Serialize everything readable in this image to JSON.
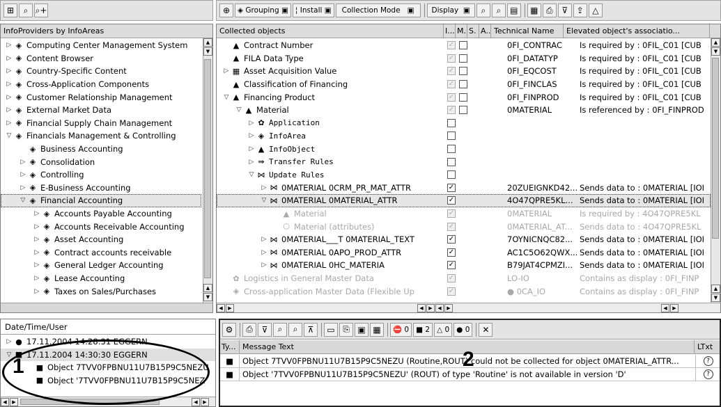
{
  "left": {
    "header": "InfoProviders by InfoAreas",
    "items": [
      {
        "label": "Computing Center Management System",
        "tw": "▷",
        "d": 0
      },
      {
        "label": "Content Browser",
        "tw": "▷",
        "d": 0
      },
      {
        "label": "Country-Specific Content",
        "tw": "▷",
        "d": 0
      },
      {
        "label": "Cross-Application Components",
        "tw": "▷",
        "d": 0
      },
      {
        "label": "Customer Relationship Management",
        "tw": "▷",
        "d": 0
      },
      {
        "label": "External Market Data",
        "tw": "▷",
        "d": 0
      },
      {
        "label": "Financial Supply Chain Management",
        "tw": "▷",
        "d": 0
      },
      {
        "label": "Financials Management & Controlling",
        "tw": "▽",
        "d": 0
      },
      {
        "label": "Business Accounting",
        "tw": "",
        "d": 1
      },
      {
        "label": "Consolidation",
        "tw": "▷",
        "d": 1
      },
      {
        "label": "Controlling",
        "tw": "▷",
        "d": 1
      },
      {
        "label": "E-Business Accounting",
        "tw": "▷",
        "d": 1
      },
      {
        "label": "Financial Accounting",
        "tw": "▽",
        "d": 1,
        "sel": true
      },
      {
        "label": "Accounts Payable Accounting",
        "tw": "▷",
        "d": 2
      },
      {
        "label": "Accounts Receivable Accounting",
        "tw": "▷",
        "d": 2
      },
      {
        "label": "Asset Accounting",
        "tw": "▷",
        "d": 2
      },
      {
        "label": "Contract accounts receivable",
        "tw": "▷",
        "d": 2
      },
      {
        "label": "General Ledger Accounting",
        "tw": "▷",
        "d": 2
      },
      {
        "label": "Lease Accounting",
        "tw": "▷",
        "d": 2
      },
      {
        "label": "Taxes on Sales/Purchases",
        "tw": "▷",
        "d": 2
      }
    ]
  },
  "toolbar": {
    "grouping": "Grouping",
    "install": "Install",
    "collection_mode": "Collection Mode",
    "display": "Display"
  },
  "grid": {
    "headers": [
      "Collected objects",
      "I...",
      "M.",
      "S.",
      "A..",
      "Technical Name",
      "Elevated object's associatio..."
    ],
    "rows": [
      {
        "name": "Contract Number",
        "tw": "",
        "d": 0,
        "ic": "▲",
        "i": "dis",
        "m": "box",
        "tech": "0FI_CONTRAC",
        "assoc": "Is required by : 0FIL_C01 [CUB"
      },
      {
        "name": "FILA Data Type",
        "tw": "",
        "d": 0,
        "ic": "▲",
        "i": "dis",
        "m": "box",
        "tech": "0FI_DATATYP",
        "assoc": "Is required by : 0FIL_C01 [CUB"
      },
      {
        "name": "Asset Acquisition Value",
        "tw": "▷",
        "d": 0,
        "ic": "▦",
        "i": "dis",
        "m": "box",
        "tech": "0FI_EQCOST",
        "assoc": "Is required by : 0FIL_C01 [CUB"
      },
      {
        "name": "Classification of Financing",
        "tw": "",
        "d": 0,
        "ic": "▲",
        "i": "dis",
        "m": "box",
        "tech": "0FI_FINCLAS",
        "assoc": "Is required by : 0FIL_C01 [CUB"
      },
      {
        "name": "Financing Product",
        "tw": "▽",
        "d": 0,
        "ic": "▲",
        "i": "dis",
        "m": "box",
        "tech": "0FI_FINPROD",
        "assoc": "Is required by : 0FIL_C01 [CUB"
      },
      {
        "name": "Material",
        "tw": "▽",
        "d": 1,
        "ic": "▲",
        "i": "dis",
        "m": "box",
        "tech": "0MATERIAL",
        "assoc": "Is referenced by : 0FI_FINPROD"
      },
      {
        "name": "Application",
        "tw": "▷",
        "d": 2,
        "ic": "✿",
        "i": "box",
        "mono": true
      },
      {
        "name": "InfoArea",
        "tw": "▷",
        "d": 2,
        "ic": "◈",
        "i": "box",
        "mono": true
      },
      {
        "name": "InfoObject",
        "tw": "▷",
        "d": 2,
        "ic": "▲",
        "i": "box",
        "mono": true
      },
      {
        "name": "Transfer Rules",
        "tw": "▷",
        "d": 2,
        "ic": "⇛",
        "i": "box",
        "mono": true
      },
      {
        "name": "Update Rules",
        "tw": "▽",
        "d": 2,
        "ic": "⋈",
        "i": "box",
        "mono": true
      },
      {
        "name": "0MATERIAL 0CRM_PR_MAT_ATTR",
        "tw": "▷",
        "d": 3,
        "ic": "⋈",
        "i": "chk",
        "tech": "20ZUEIGNKD42...",
        "assoc": "Sends data to : 0MATERIAL [IOI"
      },
      {
        "name": "0MATERIAL 0MATERIAL_ATTR",
        "tw": "▽",
        "d": 3,
        "ic": "⋈",
        "i": "chk",
        "tech": "4O47QPRE5KL...",
        "assoc": "Sends data to : 0MATERIAL [IOI",
        "sel": true
      },
      {
        "name": "Material",
        "tw": "",
        "d": 4,
        "ic": "▲",
        "i": "dis",
        "grey": true,
        "tech": "0MATERIAL",
        "assoc": "Is required by : 4O47QPRE5KL"
      },
      {
        "name": "Material (attributes)",
        "tw": "",
        "d": 4,
        "ic": "⬡",
        "i": "dis",
        "grey": true,
        "tech": "0MATERIAL_AT...",
        "assoc": "Sends data to : 4O47QPRE5KL"
      },
      {
        "name": "0MATERIAL___T 0MATERIAL_TEXT",
        "tw": "▷",
        "d": 3,
        "ic": "⋈",
        "i": "chk",
        "tech": "7OYNICNQC82...",
        "assoc": "Sends data to : 0MATERIAL [IOI"
      },
      {
        "name": "0MATERIAL 0APO_PROD_ATTR",
        "tw": "▷",
        "d": 3,
        "ic": "⋈",
        "i": "chk",
        "tech": "AC1C5O62QWX...",
        "assoc": "Sends data to : 0MATERIAL [IOI"
      },
      {
        "name": "0MATERIAL 0HC_MATERIA",
        "tw": "▷",
        "d": 3,
        "ic": "⋈",
        "i": "chk",
        "tech": "B79JAT4CPMZI...",
        "assoc": "Sends data to : 0MATERIAL [IOI"
      },
      {
        "name": "Logistics in General Master Data",
        "tw": "",
        "d": 0,
        "ic": "✿",
        "i": "dis",
        "grey": true,
        "tech": "LO-IO",
        "assoc": "Contains as display : 0FI_FINP"
      },
      {
        "name": "Cross-application Master Data (Flexible Up",
        "tw": "",
        "d": 0,
        "ic": "◈",
        "i": "dis",
        "grey": true,
        "tech": "● 0CA_IO",
        "assoc": "Contains as display : 0FI_FINP"
      }
    ]
  },
  "log": {
    "header": "Date/Time/User",
    "items": [
      {
        "text": "17.11.2004  14:28:31  EGGERN",
        "tw": "▷",
        "d": 0,
        "ic": "●"
      },
      {
        "text": "17.11.2004  14:30:30  EGGERN",
        "tw": "▽",
        "d": 0,
        "ic": "■"
      },
      {
        "text": "Object 7TVV0FPBNU11U7B15P9C5NEZU",
        "tw": "",
        "d": 1,
        "ic": "■"
      },
      {
        "text": "Object '7TVV0FPBNU11U7B15P9C5NEZ",
        "tw": "",
        "d": 1,
        "ic": "■"
      }
    ]
  },
  "messages": {
    "counters": {
      "stop": "0",
      "error": "2",
      "warning": "0",
      "info": "0"
    },
    "headers": [
      "Ty...",
      "Message Text",
      "LTxt"
    ],
    "rows": [
      {
        "text": "Object 7TVV0FPBNU11U7B15P9C5NEZU (Routine,ROUT) could not be collected for object 0MATERIAL_ATTR..."
      },
      {
        "text": "Object '7TVV0FPBNU11U7B15P9C5NEZU' (ROUT) of type 'Routine' is not available in version 'D'"
      }
    ]
  },
  "callouts": {
    "one": "1",
    "two": "2"
  }
}
